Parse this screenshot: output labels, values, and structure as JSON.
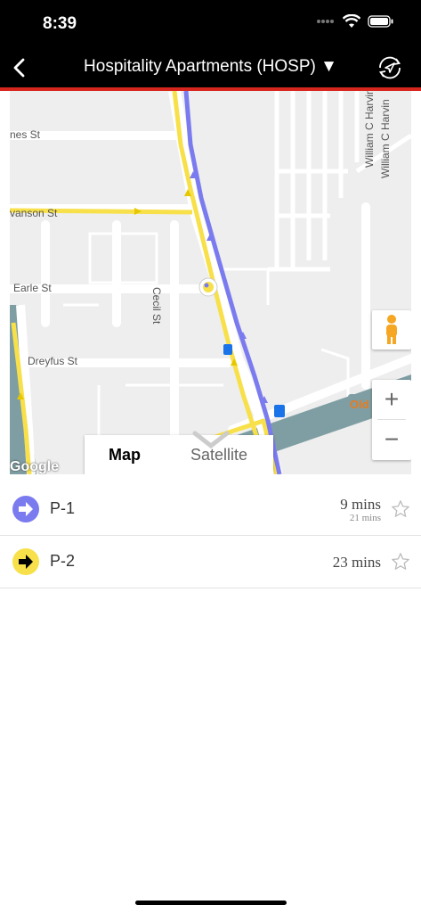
{
  "status_bar": {
    "time": "8:39"
  },
  "nav": {
    "title": "Hospitality Apartments (HOSP) ▼"
  },
  "map": {
    "street_labels": {
      "nes": "nes St",
      "vanson": "vanson St",
      "earle": "Earle St",
      "dreyfus": "Dreyfus St",
      "cecil": "Cecil St",
      "william1": "William C Harvin",
      "william2": "William C Harvin",
      "old": "Old"
    },
    "zoom_in": "+",
    "zoom_out": "−",
    "map_type_map": "Map",
    "map_type_satellite": "Satellite",
    "logo": "Google",
    "colors": {
      "purple_route": "#7b7bf0",
      "yellow_route": "#f7e04a",
      "water": "#7f9ea3"
    }
  },
  "routes": [
    {
      "name": "P-1",
      "time": "9 mins",
      "subtime": "21 mins",
      "color": "#7b7bf0"
    },
    {
      "name": "P-2",
      "time": "23 mins",
      "color": "#f7e04a"
    }
  ]
}
